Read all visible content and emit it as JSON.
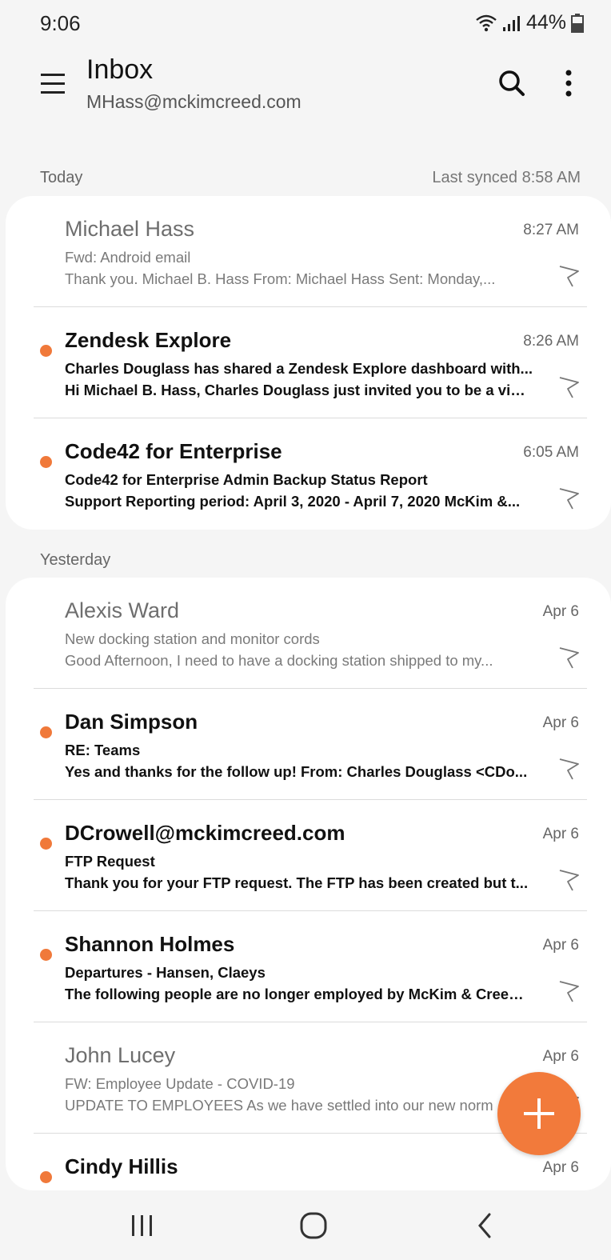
{
  "status": {
    "time": "9:06",
    "battery": "44%"
  },
  "header": {
    "title": "Inbox",
    "account": "MHass@mckimcreed.com"
  },
  "sections": {
    "today": {
      "label": "Today",
      "synced": "Last synced  8:58 AM"
    },
    "yesterday": {
      "label": "Yesterday"
    }
  },
  "today_emails": [
    {
      "sender": "Michael Hass",
      "subject": "Fwd: Android email",
      "preview": "Thank you.  Michael B. Hass  From: Michael Hass  Sent: Monday,...",
      "date": "8:27 AM"
    },
    {
      "sender": "Zendesk Explore",
      "subject": "Charles Douglass has shared a Zendesk Explore dashboard with...",
      "preview": "Hi Michael B. Hass,  Charles Douglass just invited you to be a vie...",
      "date": "8:26 AM"
    },
    {
      "sender": "Code42 for Enterprise",
      "subject": "Code42 for Enterprise Admin Backup Status Report",
      "preview": "Support  Reporting period: April 3, 2020 - April 7, 2020  McKim &...",
      "date": "6:05 AM"
    }
  ],
  "yesterday_emails": [
    {
      "sender": "Alexis Ward",
      "subject": "New docking station and monitor cords",
      "preview": "Good Afternoon,   I need to have a docking station shipped to my...",
      "date": "Apr 6"
    },
    {
      "sender": "Dan Simpson",
      "subject": "RE: Teams",
      "preview": "Yes and thanks for the follow up!   From: Charles Douglass <CDo...",
      "date": "Apr 6"
    },
    {
      "sender": "DCrowell@mckimcreed.com",
      "subject": "FTP Request",
      "preview": "Thank you for your FTP request.  The FTP has been created but t...",
      "date": "Apr 6"
    },
    {
      "sender": "Shannon Holmes",
      "subject": "Departures - Hansen, Claeys",
      "preview": "The following people are no longer employed by McKim & Creed....",
      "date": "Apr 6"
    },
    {
      "sender": "John Lucey",
      "subject": "FW: Employee Update - COVID-19",
      "preview": "UPDATE TO EMPLOYEES  As we have settled into our new norm",
      "date": "Apr 6"
    },
    {
      "sender": "Cindy Hillis",
      "subject": "",
      "preview": "",
      "date": "Apr 6"
    }
  ],
  "colors": {
    "accent": "#f27a3b",
    "unread_dot": "#f0793a"
  },
  "icons": {
    "menu": "hamburger-icon",
    "search": "search-icon",
    "more": "more-vert-icon",
    "flag": "flag-icon",
    "compose": "plus-icon"
  }
}
